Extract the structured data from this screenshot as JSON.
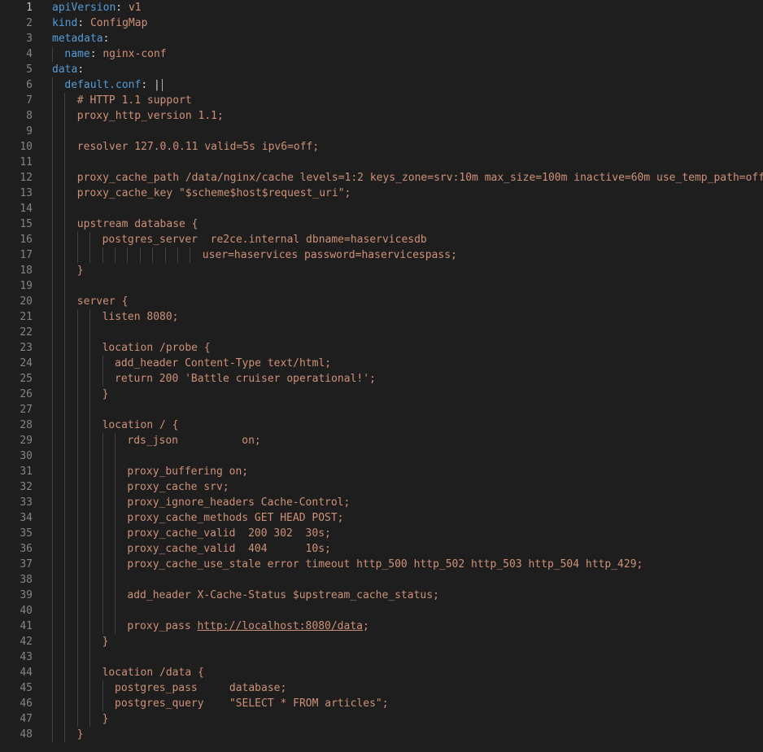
{
  "editor": {
    "current_line": 1,
    "theme_colors": {
      "background": "#1e1e1e",
      "key": "#569cd6",
      "string": "#ce9178",
      "line_number": "#858585",
      "indent_guide": "#404040"
    },
    "lines": [
      {
        "n": "1",
        "indent": 0,
        "parts": [
          {
            "t": "apiVersion",
            "c": "key"
          },
          {
            "t": ": ",
            "c": "pl"
          },
          {
            "t": "v1",
            "c": "str"
          }
        ]
      },
      {
        "n": "2",
        "indent": 0,
        "parts": [
          {
            "t": "kind",
            "c": "key"
          },
          {
            "t": ": ",
            "c": "pl"
          },
          {
            "t": "ConfigMap",
            "c": "str"
          }
        ]
      },
      {
        "n": "3",
        "indent": 0,
        "parts": [
          {
            "t": "metadata",
            "c": "key"
          },
          {
            "t": ":",
            "c": "pl"
          }
        ]
      },
      {
        "n": "4",
        "indent": 1,
        "parts": [
          {
            "t": "name",
            "c": "key"
          },
          {
            "t": ": ",
            "c": "pl"
          },
          {
            "t": "nginx-conf",
            "c": "str"
          }
        ]
      },
      {
        "n": "5",
        "indent": 0,
        "parts": [
          {
            "t": "data",
            "c": "key"
          },
          {
            "t": ":",
            "c": "pl"
          }
        ]
      },
      {
        "n": "6",
        "indent": 1,
        "parts": [
          {
            "t": "default.conf",
            "c": "key"
          },
          {
            "t": ": ",
            "c": "pl"
          },
          {
            "t": "|",
            "c": "pl"
          }
        ]
      },
      {
        "n": "7",
        "indent": 2,
        "parts": [
          {
            "t": "# HTTP 1.1 support",
            "c": "txt"
          }
        ]
      },
      {
        "n": "8",
        "indent": 2,
        "parts": [
          {
            "t": "proxy_http_version 1.1;",
            "c": "txt"
          }
        ]
      },
      {
        "n": "9",
        "indent": 2,
        "parts": []
      },
      {
        "n": "10",
        "indent": 2,
        "parts": [
          {
            "t": "resolver 127.0.0.11 valid=5s ipv6=off;",
            "c": "txt"
          }
        ]
      },
      {
        "n": "11",
        "indent": 2,
        "parts": []
      },
      {
        "n": "12",
        "indent": 2,
        "parts": [
          {
            "t": "proxy_cache_path /data/nginx/cache levels=1:2 keys_zone=srv:10m max_size=100m inactive=60m use_temp_path=off;",
            "c": "txt"
          }
        ]
      },
      {
        "n": "13",
        "indent": 2,
        "parts": [
          {
            "t": "proxy_cache_key \"$scheme$host$request_uri\";",
            "c": "txt"
          }
        ]
      },
      {
        "n": "14",
        "indent": 2,
        "parts": []
      },
      {
        "n": "15",
        "indent": 2,
        "parts": [
          {
            "t": "upstream database {",
            "c": "txt"
          }
        ]
      },
      {
        "n": "16",
        "indent": 4,
        "parts": [
          {
            "t": "postgres_server  re2ce.internal dbname=haservicesdb",
            "c": "txt"
          }
        ]
      },
      {
        "n": "17",
        "indent": 12,
        "parts": [
          {
            "t": "user=haservices password=haservicespass;",
            "c": "txt"
          }
        ]
      },
      {
        "n": "18",
        "indent": 2,
        "parts": [
          {
            "t": "}",
            "c": "txt"
          }
        ]
      },
      {
        "n": "19",
        "indent": 2,
        "parts": []
      },
      {
        "n": "20",
        "indent": 2,
        "parts": [
          {
            "t": "server {",
            "c": "txt"
          }
        ]
      },
      {
        "n": "21",
        "indent": 4,
        "parts": [
          {
            "t": "listen 8080;",
            "c": "txt"
          }
        ]
      },
      {
        "n": "22",
        "indent": 4,
        "parts": []
      },
      {
        "n": "23",
        "indent": 4,
        "parts": [
          {
            "t": "location /probe {",
            "c": "txt"
          }
        ]
      },
      {
        "n": "24",
        "indent": 5,
        "parts": [
          {
            "t": "add_header Content-Type text/html;",
            "c": "txt"
          }
        ]
      },
      {
        "n": "25",
        "indent": 5,
        "parts": [
          {
            "t": "return 200 'Battle cruiser operational!';",
            "c": "txt"
          }
        ]
      },
      {
        "n": "26",
        "indent": 4,
        "parts": [
          {
            "t": "}",
            "c": "txt"
          }
        ]
      },
      {
        "n": "27",
        "indent": 4,
        "parts": []
      },
      {
        "n": "28",
        "indent": 4,
        "parts": [
          {
            "t": "location / {",
            "c": "txt"
          }
        ]
      },
      {
        "n": "29",
        "indent": 6,
        "parts": [
          {
            "t": "rds_json          on;",
            "c": "txt"
          }
        ]
      },
      {
        "n": "30",
        "indent": 6,
        "parts": []
      },
      {
        "n": "31",
        "indent": 6,
        "parts": [
          {
            "t": "proxy_buffering on;",
            "c": "txt"
          }
        ]
      },
      {
        "n": "32",
        "indent": 6,
        "parts": [
          {
            "t": "proxy_cache srv;",
            "c": "txt"
          }
        ]
      },
      {
        "n": "33",
        "indent": 6,
        "parts": [
          {
            "t": "proxy_ignore_headers Cache-Control;",
            "c": "txt"
          }
        ]
      },
      {
        "n": "34",
        "indent": 6,
        "parts": [
          {
            "t": "proxy_cache_methods GET HEAD POST;",
            "c": "txt"
          }
        ]
      },
      {
        "n": "35",
        "indent": 6,
        "parts": [
          {
            "t": "proxy_cache_valid  200 302  30s;",
            "c": "txt"
          }
        ]
      },
      {
        "n": "36",
        "indent": 6,
        "parts": [
          {
            "t": "proxy_cache_valid  404      10s;",
            "c": "txt"
          }
        ]
      },
      {
        "n": "37",
        "indent": 6,
        "parts": [
          {
            "t": "proxy_cache_use_stale error timeout http_500 http_502 http_503 http_504 http_429;",
            "c": "txt"
          }
        ]
      },
      {
        "n": "38",
        "indent": 6,
        "parts": []
      },
      {
        "n": "39",
        "indent": 6,
        "parts": [
          {
            "t": "add_header X-Cache-Status $upstream_cache_status;",
            "c": "txt"
          }
        ]
      },
      {
        "n": "40",
        "indent": 6,
        "parts": []
      },
      {
        "n": "41",
        "indent": 6,
        "parts": [
          {
            "t": "proxy_pass ",
            "c": "txt"
          },
          {
            "t": "http://localhost:8080/data",
            "c": "txt url"
          },
          {
            "t": ";",
            "c": "txt"
          }
        ]
      },
      {
        "n": "42",
        "indent": 4,
        "parts": [
          {
            "t": "}",
            "c": "txt"
          }
        ]
      },
      {
        "n": "43",
        "indent": 4,
        "parts": []
      },
      {
        "n": "44",
        "indent": 4,
        "parts": [
          {
            "t": "location /data {",
            "c": "txt"
          }
        ]
      },
      {
        "n": "45",
        "indent": 5,
        "parts": [
          {
            "t": "postgres_pass     database;",
            "c": "txt"
          }
        ]
      },
      {
        "n": "46",
        "indent": 5,
        "parts": [
          {
            "t": "postgres_query    \"SELECT * FROM articles\";",
            "c": "txt"
          }
        ]
      },
      {
        "n": "47",
        "indent": 4,
        "parts": [
          {
            "t": "}",
            "c": "txt"
          }
        ]
      },
      {
        "n": "48",
        "indent": 2,
        "parts": [
          {
            "t": "}",
            "c": "txt"
          }
        ]
      }
    ]
  }
}
